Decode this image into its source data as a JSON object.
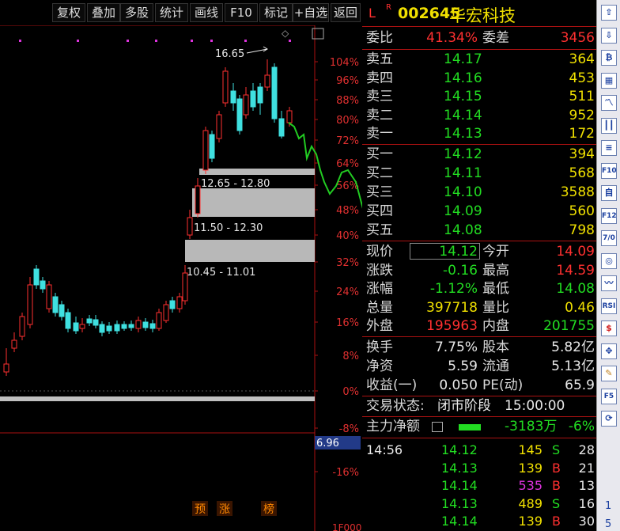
{
  "toolbar": [
    "复权",
    "叠加",
    "多股",
    "统计",
    "画线",
    "F10",
    "标记",
    "+自选",
    "返回"
  ],
  "stock": {
    "prefix_l": "L",
    "prefix_r": "R",
    "code": "002645",
    "name": "华宏科技"
  },
  "weibi": {
    "label": "委比",
    "value": "41.34%",
    "label2": "委差",
    "value2": "3456"
  },
  "asks": [
    {
      "label": "卖五",
      "price": "14.17",
      "vol": "364"
    },
    {
      "label": "卖四",
      "price": "14.16",
      "vol": "453"
    },
    {
      "label": "卖三",
      "price": "14.15",
      "vol": "511"
    },
    {
      "label": "卖二",
      "price": "14.14",
      "vol": "952"
    },
    {
      "label": "卖一",
      "price": "14.13",
      "vol": "172"
    }
  ],
  "bids": [
    {
      "label": "买一",
      "price": "14.12",
      "vol": "394"
    },
    {
      "label": "买二",
      "price": "14.11",
      "vol": "568"
    },
    {
      "label": "买三",
      "price": "14.10",
      "vol": "3588"
    },
    {
      "label": "买四",
      "price": "14.09",
      "vol": "560"
    },
    {
      "label": "买五",
      "price": "14.08",
      "vol": "798"
    }
  ],
  "stats": [
    {
      "l1": "现价",
      "v1": "14.12",
      "l2": "今开",
      "v2": "14.09"
    },
    {
      "l1": "涨跌",
      "v1": "-0.16",
      "l2": "最高",
      "v2": "14.59"
    },
    {
      "l1": "涨幅",
      "v1": "-1.12%",
      "l2": "最低",
      "v2": "14.08"
    },
    {
      "l1": "总量",
      "v1": "397718",
      "l2": "量比",
      "v2": "0.46"
    },
    {
      "l1": "外盘",
      "v1": "195963",
      "l2": "内盘",
      "v2": "201755"
    }
  ],
  "fin": [
    {
      "l1": "换手",
      "v1": "7.75%",
      "l2": "股本",
      "v2": "5.82亿"
    },
    {
      "l1": "净资",
      "v1": "5.59",
      "l2": "流通",
      "v2": "5.13亿"
    },
    {
      "l1": "收益(一)",
      "v1": "0.050",
      "l2": "PE(动)",
      "v2": "65.9"
    }
  ],
  "status": {
    "label": "交易状态:",
    "value": "闭市阶段",
    "time": "15:00:00"
  },
  "mainflow": {
    "label": "主力净额",
    "value": "-3183万",
    "pct": "-6%"
  },
  "ticks": [
    {
      "time": "14:56",
      "price": "14.12",
      "vol": "145",
      "side": "S",
      "n": "28"
    },
    {
      "time": "",
      "price": "14.13",
      "vol": "139",
      "side": "B",
      "n": "21"
    },
    {
      "time": "",
      "price": "14.14",
      "vol": "535",
      "side": "B",
      "n": "13"
    },
    {
      "time": "",
      "price": "14.13",
      "vol": "489",
      "side": "S",
      "n": "16"
    },
    {
      "time": "",
      "price": "14.14",
      "vol": "139",
      "side": "B",
      "n": "30"
    }
  ],
  "chart": {
    "pct_labels": [
      "104%",
      "96%",
      "88%",
      "80%",
      "72%",
      "64%",
      "56%",
      "48%",
      "40%",
      "32%",
      "24%",
      "16%",
      "8%",
      "0%",
      "-8%",
      "-16%"
    ],
    "peak_label": "16.65",
    "zones": [
      "12.65 - 12.80",
      "11.50 - 12.30",
      "10.45 - 11.01"
    ],
    "price_tag": "6.96",
    "badges": [
      "预",
      "涨",
      "榜"
    ],
    "bottom_label": "1F000"
  },
  "sidebar_icons": [
    "up-arrow-icon",
    "down-arrow-icon",
    "cross-icon",
    "grid-icon",
    "line-chart-icon",
    "candle-icon",
    "list-icon",
    "f10-icon",
    "bank-icon",
    "f12-icon",
    "f7-icon",
    "circle-icon",
    "wave-icon",
    "rsi-icon",
    "dollar-icon",
    "move-icon",
    "pencil-icon",
    "f5-icon",
    "refresh-icon"
  ],
  "sidebar_text": {
    "f10": "F10",
    "f12": "F12",
    "rsi": "RSI",
    "f5": "F5",
    "bank": "自",
    "f7": "7/0",
    "num1": "1",
    "num5": "5"
  }
}
